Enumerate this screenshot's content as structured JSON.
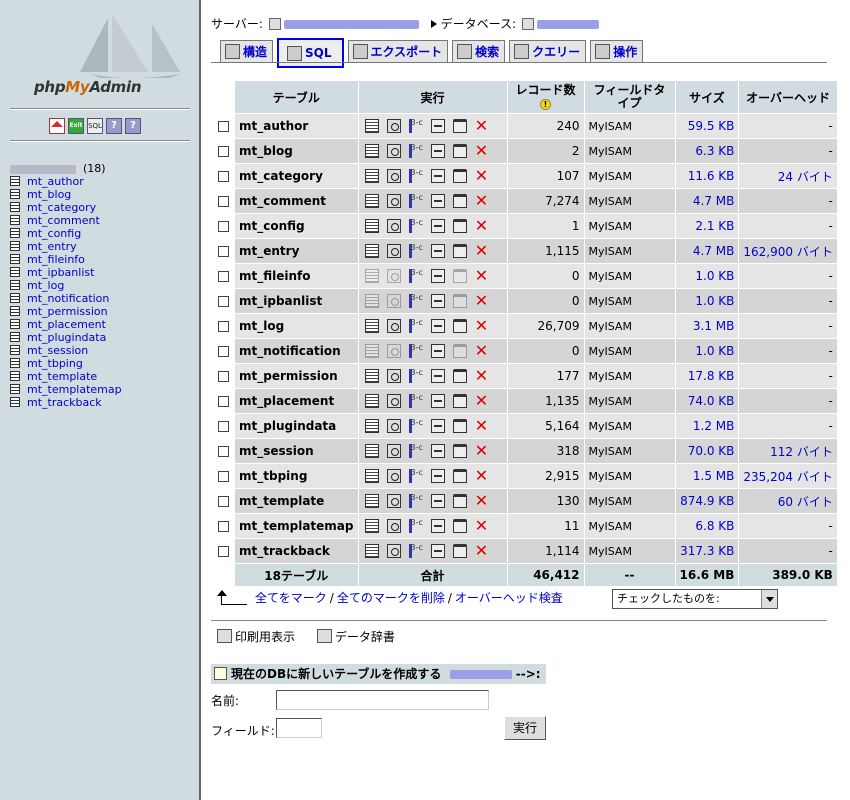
{
  "left": {
    "logo_text_a": "php",
    "logo_text_b": "My",
    "logo_text_c": "Admin",
    "icons": [
      "home-icon",
      "exit-icon",
      "sql-icon",
      "help-icon",
      "docs-icon"
    ],
    "db_count": "(18)",
    "tables": [
      "mt_author",
      "mt_blog",
      "mt_category",
      "mt_comment",
      "mt_config",
      "mt_entry",
      "mt_fileinfo",
      "mt_ipbanlist",
      "mt_log",
      "mt_notification",
      "mt_permission",
      "mt_placement",
      "mt_plugindata",
      "mt_session",
      "mt_tbping",
      "mt_template",
      "mt_templatemap",
      "mt_trackback"
    ]
  },
  "crumb": {
    "server_label": "サーバー:",
    "db_label": "データベース:"
  },
  "tabs": [
    {
      "label": "構造",
      "icon": "structure-icon"
    },
    {
      "label": "SQL",
      "icon": "sql-icon",
      "active": true
    },
    {
      "label": "エクスポート",
      "icon": "export-icon"
    },
    {
      "label": "検索",
      "icon": "search-icon"
    },
    {
      "label": "クエリー",
      "icon": "query-icon"
    },
    {
      "label": "操作",
      "icon": "operations-icon"
    }
  ],
  "table": {
    "headers": {
      "table": "テーブル",
      "action": "実行",
      "records": "レコード数",
      "field_type": "フィールドタイプ",
      "size": "サイズ",
      "overhead": "オーバーヘッド"
    },
    "rows": [
      {
        "name": "mt_author",
        "records": "240",
        "type": "MyISAM",
        "size": "59.5 KB",
        "overhead": "-",
        "empty": false
      },
      {
        "name": "mt_blog",
        "records": "2",
        "type": "MyISAM",
        "size": "6.3 KB",
        "overhead": "-",
        "empty": false
      },
      {
        "name": "mt_category",
        "records": "107",
        "type": "MyISAM",
        "size": "11.6 KB",
        "overhead": "24 バイト",
        "empty": false
      },
      {
        "name": "mt_comment",
        "records": "7,274",
        "type": "MyISAM",
        "size": "4.7 MB",
        "overhead": "-",
        "empty": false
      },
      {
        "name": "mt_config",
        "records": "1",
        "type": "MyISAM",
        "size": "2.1 KB",
        "overhead": "-",
        "empty": false
      },
      {
        "name": "mt_entry",
        "records": "1,115",
        "type": "MyISAM",
        "size": "4.7 MB",
        "overhead": "162,900 バイト",
        "empty": false
      },
      {
        "name": "mt_fileinfo",
        "records": "0",
        "type": "MyISAM",
        "size": "1.0 KB",
        "overhead": "-",
        "empty": true
      },
      {
        "name": "mt_ipbanlist",
        "records": "0",
        "type": "MyISAM",
        "size": "1.0 KB",
        "overhead": "-",
        "empty": true
      },
      {
        "name": "mt_log",
        "records": "26,709",
        "type": "MyISAM",
        "size": "3.1 MB",
        "overhead": "-",
        "empty": false
      },
      {
        "name": "mt_notification",
        "records": "0",
        "type": "MyISAM",
        "size": "1.0 KB",
        "overhead": "-",
        "empty": true
      },
      {
        "name": "mt_permission",
        "records": "177",
        "type": "MyISAM",
        "size": "17.8 KB",
        "overhead": "-",
        "empty": false
      },
      {
        "name": "mt_placement",
        "records": "1,135",
        "type": "MyISAM",
        "size": "74.0 KB",
        "overhead": "-",
        "empty": false
      },
      {
        "name": "mt_plugindata",
        "records": "5,164",
        "type": "MyISAM",
        "size": "1.2 MB",
        "overhead": "-",
        "empty": false
      },
      {
        "name": "mt_session",
        "records": "318",
        "type": "MyISAM",
        "size": "70.0 KB",
        "overhead": "112 バイト",
        "empty": false
      },
      {
        "name": "mt_tbping",
        "records": "2,915",
        "type": "MyISAM",
        "size": "1.5 MB",
        "overhead": "235,204 バイト",
        "empty": false
      },
      {
        "name": "mt_template",
        "records": "130",
        "type": "MyISAM",
        "size": "874.9 KB",
        "overhead": "60 バイト",
        "empty": false
      },
      {
        "name": "mt_templatemap",
        "records": "11",
        "type": "MyISAM",
        "size": "6.8 KB",
        "overhead": "-",
        "empty": false
      },
      {
        "name": "mt_trackback",
        "records": "1,114",
        "type": "MyISAM",
        "size": "317.3 KB",
        "overhead": "-",
        "empty": false
      }
    ],
    "footer": {
      "count": "18テーブル",
      "sum_label": "合計",
      "records": "46,412",
      "type": "--",
      "size": "16.6 MB",
      "overhead": "389.0 KB"
    }
  },
  "mark": {
    "check_all": "全てをマーク",
    "uncheck_all": "全てのマークを削除",
    "overhead_check": "オーバーヘッド検査",
    "sep": "/",
    "with_selected": "チェックしたものを:"
  },
  "print": {
    "print_view": "印刷用表示",
    "data_dict": "データ辞書"
  },
  "create": {
    "heading": "現在のDBに新しいテーブルを作成する",
    "heading_tail": "-->:",
    "name_label": "名前:",
    "fields_label": "フィールド:",
    "go": "実行"
  },
  "colors": {
    "header_bg": "#d0dce0",
    "row_a": "#e5e5e5",
    "row_b": "#d5d5d5",
    "link": "#0000cc",
    "active_tab_border": "#0000ee"
  }
}
